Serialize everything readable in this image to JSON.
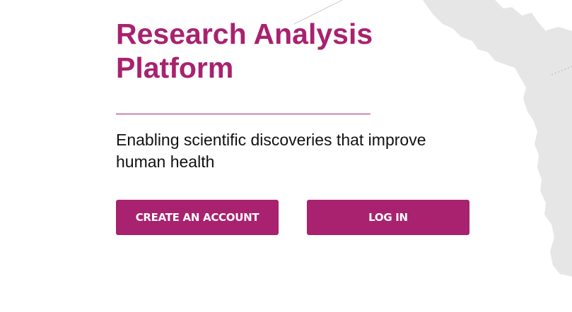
{
  "theme": {
    "brand_color": "#a8226f",
    "text_color": "#111111",
    "map_color": "#e6e6e6"
  },
  "hero": {
    "title": "Research Analysis Platform",
    "tagline": "Enabling scientific discoveries that improve human health"
  },
  "actions": {
    "create_account_label": "CREATE AN ACCOUNT",
    "login_label": "LOG IN"
  }
}
